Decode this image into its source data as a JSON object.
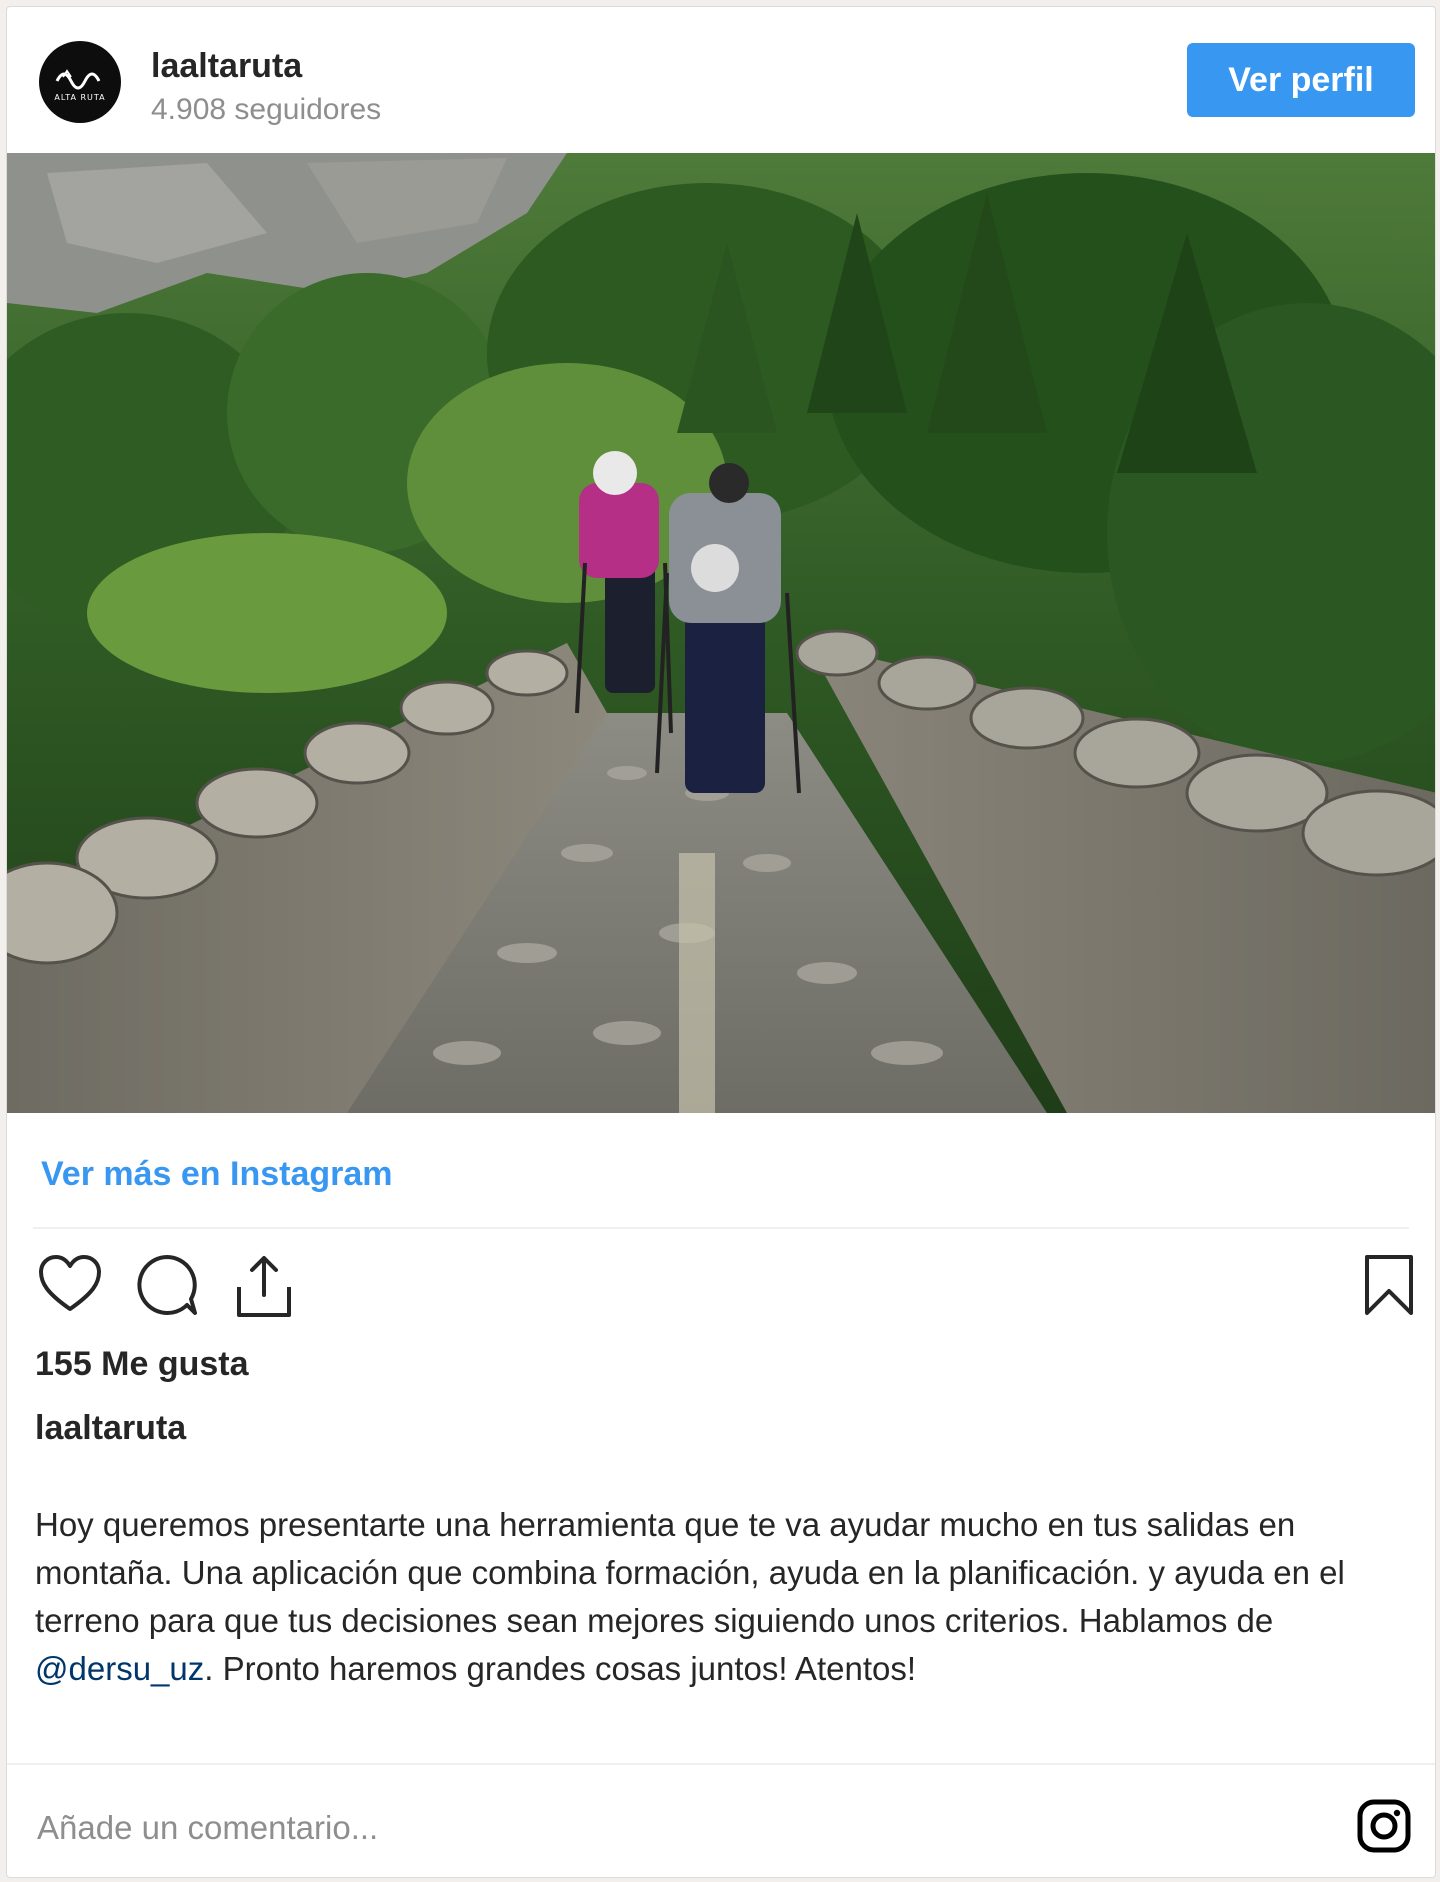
{
  "header": {
    "username": "laaltaruta",
    "followers": "4.908 seguidores",
    "view_profile_label": "Ver perfil",
    "avatar_text": "ALTA RUTA"
  },
  "photo": {
    "icon": "hikers-on-stone-bridge-photo"
  },
  "see_more_label": "Ver más en Instagram",
  "actions": {
    "icons": [
      "heart-icon",
      "comment-icon",
      "share-icon",
      "bookmark-icon"
    ]
  },
  "likes": "155 Me gusta",
  "owner": "laaltaruta",
  "caption": {
    "before": "Hoy queremos presentarte una herramienta que te va ayudar mucho en tus salidas en montaña. Una aplicación que combina formación, ayuda en la planificación. y ayuda en el terreno para que tus decisiones sean mejores siguiendo unos criterios. Hablamos de ",
    "mention": "@dersu_uz",
    "after": ". Pronto haremos grandes cosas juntos! Atentos!"
  },
  "comment": {
    "placeholder": "Añade un comentario..."
  },
  "colors": {
    "accent": "#3897f0",
    "mention": "#00376b",
    "muted": "#8e8e8e"
  }
}
